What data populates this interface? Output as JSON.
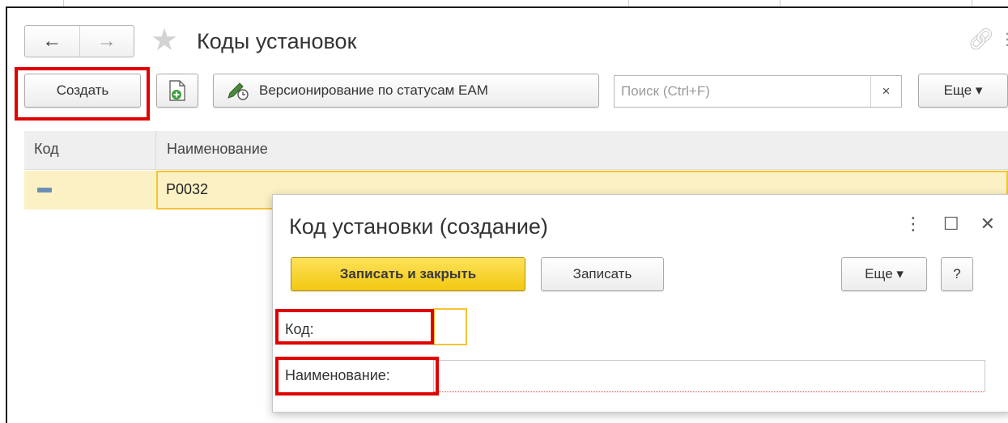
{
  "window": {
    "title": "Коды установок",
    "nav": {
      "back": "←",
      "forward": "→"
    }
  },
  "toolbar": {
    "create_label": "Создать",
    "versioning_label": "Версионирование по статусам EAM",
    "search_placeholder": "Поиск (Ctrl+F)",
    "search_clear": "×",
    "more_label": "Еще ▾"
  },
  "table": {
    "columns": [
      "Код",
      "Наименование"
    ],
    "rows": [
      {
        "code": "",
        "name": "P0032"
      }
    ]
  },
  "dialog": {
    "title": "Код установки (создание)",
    "buttons": {
      "save_close": "Записать и закрыть",
      "save": "Записать",
      "more": "Еще ▾",
      "help": "?"
    },
    "fields": {
      "code_label": "Код:",
      "code_value": "",
      "name_label": "Наименование:",
      "name_value": ""
    },
    "window_controls": {
      "menu": "⋮",
      "maximize": "☐",
      "close": "✕"
    }
  },
  "colors": {
    "highlight": "#e00000",
    "primary_button": "#f2c811",
    "selected_row": "#fbf1c4",
    "cell_border": "#f5c333"
  }
}
